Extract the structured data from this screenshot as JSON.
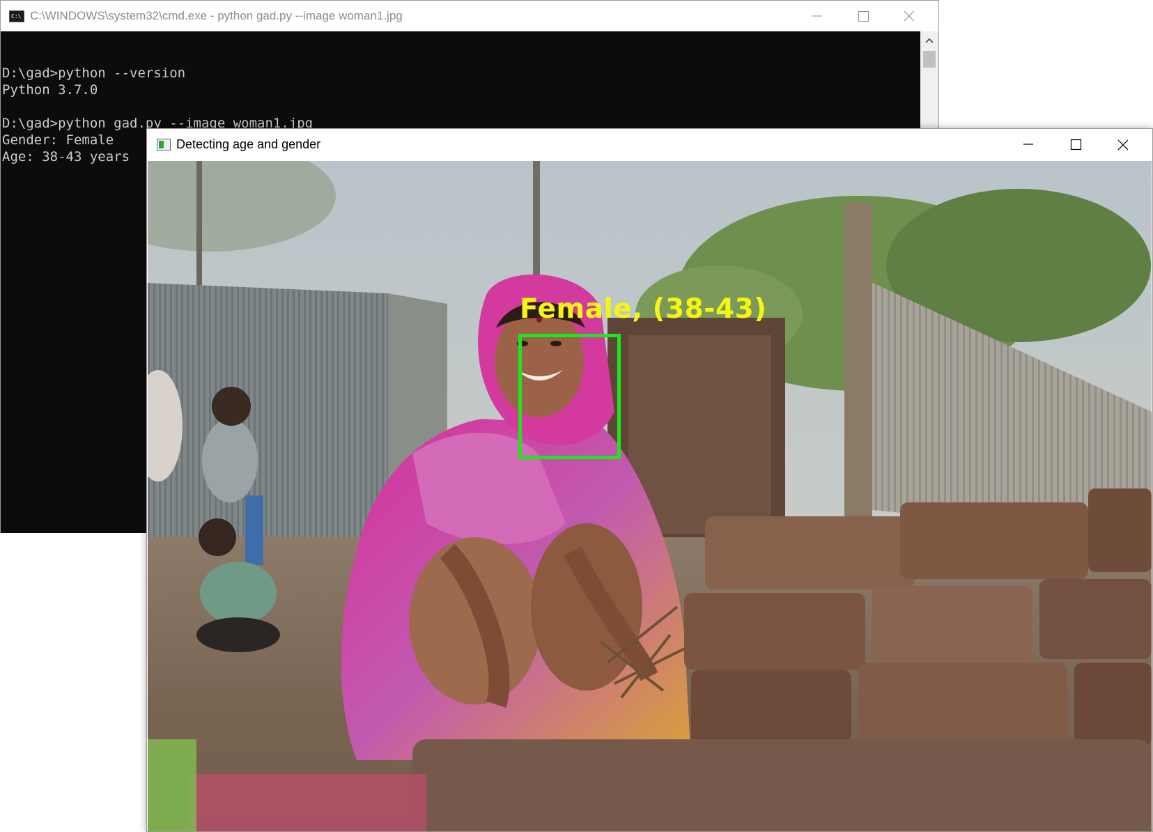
{
  "cmd_window": {
    "title": "C:\\WINDOWS\\system32\\cmd.exe - python  gad.py --image woman1.jpg",
    "icon": "console-icon",
    "icon_text": "C:\\",
    "lines": [
      "",
      "D:\\gad>python --version",
      "Python 3.7.0",
      "",
      "D:\\gad>python gad.py --image woman1.jpg",
      "Gender: Female",
      "Age: 38-43 years"
    ]
  },
  "image_window": {
    "title": "Detecting age and gender",
    "icon": "image-window-icon",
    "detection": {
      "label": "Female, (38-43)",
      "label_color": "#f5f512",
      "box_color": "#1ee61e"
    }
  },
  "colors": {
    "console_bg": "#0c0c0c",
    "console_text": "#cccccc"
  }
}
